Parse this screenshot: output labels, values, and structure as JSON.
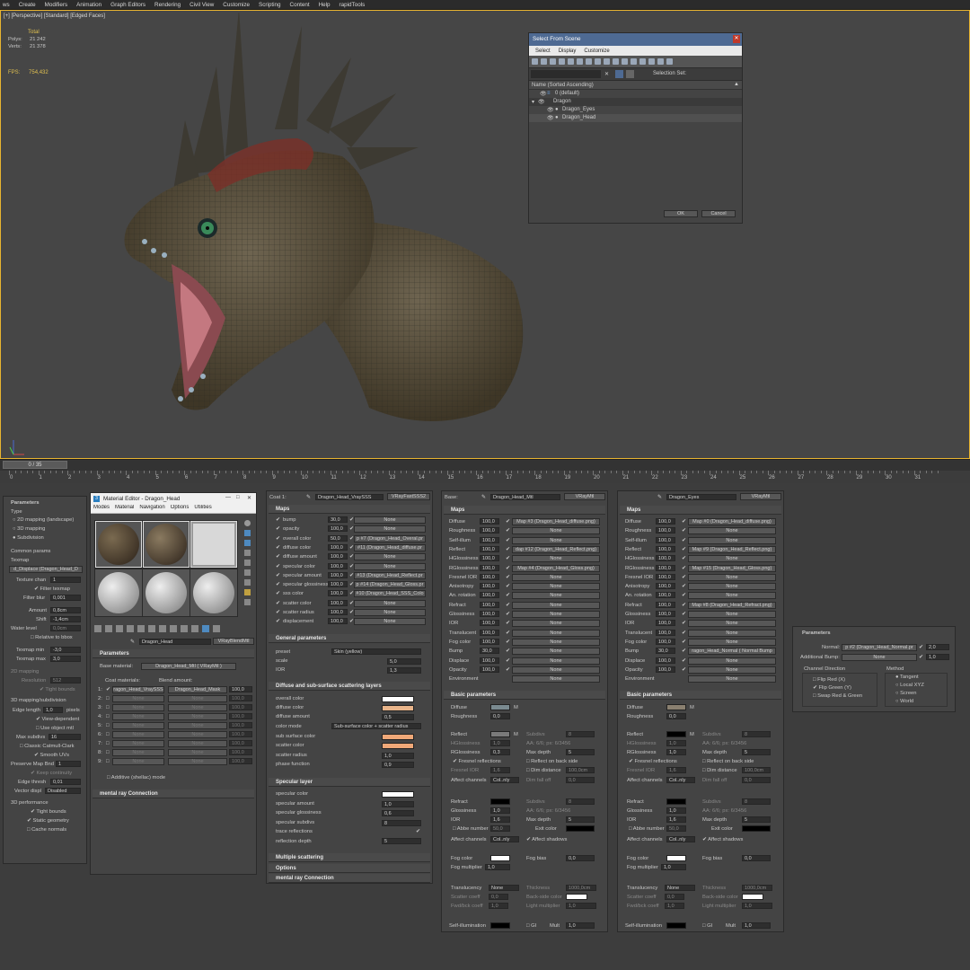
{
  "menubar": [
    "ws",
    "Create",
    "Modifiers",
    "Animation",
    "Graph Editors",
    "Rendering",
    "Civil View",
    "Customize",
    "Scripting",
    "Content",
    "Help",
    "rapidTools"
  ],
  "viewport": {
    "label": "[+] [Perspective] [Standard] [Edged Faces]",
    "stats": {
      "total_label": "Total",
      "polys_label": "Polys:",
      "polys": "21 242",
      "verts_label": "Verts:",
      "verts": "21 378"
    },
    "fps_label": "FPS:",
    "fps": "754,432"
  },
  "select_dialog": {
    "title": "Select From Scene",
    "menu": [
      "Select",
      "Display",
      "Customize"
    ],
    "selection_set_label": "Selection Set:",
    "column_header": "Name (Sorted Ascending)",
    "items": [
      {
        "name": "0 (default)",
        "indent": 1
      },
      {
        "name": "Dragon",
        "indent": 1
      },
      {
        "name": "Dragon_Eyes",
        "indent": 2
      },
      {
        "name": "Dragon_Head",
        "indent": 2
      }
    ],
    "ok": "OK",
    "cancel": "Cancel"
  },
  "timeline": {
    "slider": "0 / 35",
    "ticks": [
      "0",
      "1",
      "2",
      "3",
      "4",
      "5",
      "6",
      "7",
      "8",
      "9",
      "10",
      "11",
      "12",
      "13",
      "14",
      "15",
      "16",
      "17",
      "18",
      "19",
      "20",
      "21",
      "22",
      "23",
      "24",
      "25",
      "26",
      "27",
      "28",
      "29",
      "30",
      "31"
    ]
  },
  "params_panel": {
    "title": "Parameters",
    "type_label": "Type",
    "type_opts": [
      "2D mapping (landscape)",
      "3D mapping",
      "Subdivision"
    ],
    "common": "Common params",
    "texmap": "Texmap",
    "texmap_value": "d_Displace (Dragon_Head_D",
    "texture_chan_label": "Texture chan",
    "texture_chan": "1",
    "filter_texmap": "Filter texmap",
    "filter_blur_label": "Filter blur",
    "filter_blur": "0,001",
    "amount_label": "Amount",
    "amount": "0,8cm",
    "shift_label": "Shift",
    "shift": "-1,4cm",
    "water_label": "Water level",
    "water": "0,0cm",
    "relative": "Relative to bbox",
    "texmap_min_label": "Texmap min",
    "texmap_min": "-3,0",
    "texmap_max_label": "Texmap max",
    "texmap_max": "3,0",
    "mapping2d": "2D mapping",
    "resolution_label": "Resolution",
    "resolution": "512",
    "tight_bounds": "Tight bounds",
    "subdiv_section": "3D mapping/subdivision",
    "edge_length_label": "Edge length",
    "edge_length": "1,0",
    "pixels": "pixels",
    "view_dep": "View-dependent",
    "use_obj": "Use object mtl",
    "max_subdivs_label": "Max subdivs",
    "max_subdivs": "16",
    "classic": "Classic Catmull-Clark",
    "smooth_uvs": "Smooth UVs",
    "preserve_label": "Preserve Map Bnd",
    "preserve": "1",
    "keep_cont": "Keep continuity",
    "edge_thresh_label": "Edge thresh",
    "edge_thresh": "0,01",
    "vector_disp_label": "Vector displ",
    "vector_disp": "Disabled",
    "perf": "3D performance",
    "tight2": "Tight bounds",
    "static_geo": "Static geometry",
    "cache": "Cache normals"
  },
  "mat_editor": {
    "title": "Material Editor - Dragon_Head",
    "menu": [
      "Modes",
      "Material",
      "Navigation",
      "Options",
      "Utilities"
    ],
    "mat_name": "Dragon_Head",
    "mat_type": "VRayBlendMtl",
    "params_title": "Parameters",
    "base_label": "Base material:",
    "base_value": "Dragon_Head_Mtl  ( VRayMtl )",
    "coat_label": "Coat materials:",
    "blend_label": "Blend amount:",
    "coats": [
      {
        "n": "1:",
        "mat": "ragon_Head_VraySSS",
        "blend": "Dragon_Head_Mask",
        "amt": "100,0"
      },
      {
        "n": "2:",
        "mat": "None",
        "blend": "None",
        "amt": "100,0"
      },
      {
        "n": "3:",
        "mat": "None",
        "blend": "None",
        "amt": "100,0"
      },
      {
        "n": "4:",
        "mat": "None",
        "blend": "None",
        "amt": "100,0"
      },
      {
        "n": "5:",
        "mat": "None",
        "blend": "None",
        "amt": "100,0"
      },
      {
        "n": "6:",
        "mat": "None",
        "blend": "None",
        "amt": "100,0"
      },
      {
        "n": "7:",
        "mat": "None",
        "blend": "None",
        "amt": "100,0"
      },
      {
        "n": "8:",
        "mat": "None",
        "blend": "None",
        "amt": "100,0"
      },
      {
        "n": "9:",
        "mat": "None",
        "blend": "None",
        "amt": "100,0"
      }
    ],
    "additive": "Additive (shellac) mode",
    "mental": "mental ray Connection"
  },
  "coat_panel": {
    "coat_label": "Coat 1:",
    "mat_name": "Dragon_Head_VraySSS",
    "mat_type": "VRayFastSSS2",
    "maps": "Maps",
    "map_rows": [
      {
        "n": "bump",
        "v": "30,0",
        "m": "None"
      },
      {
        "n": "opacity",
        "v": "100,0",
        "m": "None"
      },
      {
        "n": "overall color",
        "v": "50,0",
        "m": "p #7 (Dragon_Head_Overal.pr"
      },
      {
        "n": "diffuse color",
        "v": "100,0",
        "m": "#11 (Dragon_Head_diffuse.pr"
      },
      {
        "n": "diffuse amount",
        "v": "100,0",
        "m": "None"
      },
      {
        "n": "specular color",
        "v": "100,0",
        "m": "None"
      },
      {
        "n": "specular amount",
        "v": "100,0",
        "m": "#13 (Dragon_Head_Reflect.pr"
      },
      {
        "n": "specular glossiness",
        "v": "100,0",
        "m": "p #14 (Dragon_Head_Gloss.pr"
      },
      {
        "n": "sss color",
        "v": "100,0",
        "m": "#10 (Dragon_Head_SSS_Colo"
      },
      {
        "n": "scatter color",
        "v": "100,0",
        "m": "None"
      },
      {
        "n": "scatter radius",
        "v": "100,0",
        "m": "None"
      },
      {
        "n": "displacement",
        "v": "100,0",
        "m": "None"
      }
    ],
    "general": "General parameters",
    "preset_label": "preset",
    "preset": "Skin (yellow)",
    "scale_label": "scale",
    "scale": "5,0",
    "ior_label": "IOR",
    "ior": "1,3",
    "diffuse_sss": "Diffuse and sub-surface scattering layers",
    "overall_color": "overall color",
    "diffuse_color": "diffuse color",
    "diffuse_amount": "diffuse amount",
    "diffuse_amount_v": "0,5",
    "color_mode": "color mode",
    "color_mode_v": "Sub-surface color + scatter radius",
    "sub_surface_color": "sub surface color",
    "scatter_color": "scatter color",
    "scatter_radius": "scatter radius",
    "scatter_radius_v": "1,0",
    "phase": "phase function",
    "phase_v": "0,9",
    "specular_layer": "Specular layer",
    "spec_color": "specular color",
    "spec_amount": "specular amount",
    "spec_amount_v": "1,0",
    "spec_gloss": "specular glossiness",
    "spec_gloss_v": "0,6",
    "spec_subdivs": "specular subdivs",
    "spec_subdivs_v": "8",
    "trace": "trace reflections",
    "refl_depth": "reflection depth",
    "refl_depth_v": "5",
    "multiple": "Multiple scattering",
    "options": "Options",
    "mental": "mental ray Connection"
  },
  "base_panel": {
    "base_label": "Base:",
    "mat_name": "Dragon_Head_Mtl",
    "mat_type": "VRayMtl",
    "maps": "Maps",
    "map_rows": [
      {
        "n": "Diffuse",
        "v": "100,0",
        "m": "Map #3 (Dragon_Head_diffuse.png)"
      },
      {
        "n": "Roughness",
        "v": "100,0",
        "m": "None"
      },
      {
        "n": "Self-illum",
        "v": "100,0",
        "m": "None"
      },
      {
        "n": "Reflect",
        "v": "100,0",
        "m": "dap #12 (Dragon_Head_Reflect.png)"
      },
      {
        "n": "HGlossiness",
        "v": "100,0",
        "m": "None"
      },
      {
        "n": "RGlossiness",
        "v": "100,0",
        "m": "Map #4 (Dragon_Head_Gloss.png)"
      },
      {
        "n": "Fresnel IOR",
        "v": "100,0",
        "m": "None"
      },
      {
        "n": "Anisotropy",
        "v": "100,0",
        "m": "None"
      },
      {
        "n": "An. rotation",
        "v": "100,0",
        "m": "None"
      },
      {
        "n": "Refract",
        "v": "100,0",
        "m": "None"
      },
      {
        "n": "Glossiness",
        "v": "100,0",
        "m": "None"
      },
      {
        "n": "IOR",
        "v": "100,0",
        "m": "None"
      },
      {
        "n": "Translucent",
        "v": "100,0",
        "m": "None"
      },
      {
        "n": "Fog color",
        "v": "100,0",
        "m": "None"
      },
      {
        "n": "Bump",
        "v": "30,0",
        "m": "None"
      },
      {
        "n": "Displace",
        "v": "100,0",
        "m": "None"
      },
      {
        "n": "Opacity",
        "v": "100,0",
        "m": "None"
      },
      {
        "n": "Environment",
        "v": "",
        "m": "None"
      }
    ],
    "basic": "Basic parameters",
    "diffuse": "Diffuse",
    "roughness": "Roughness",
    "roughness_v": "0,0",
    "reflect": "Reflect",
    "subdivs": "Subdivs",
    "subdivs_v": "8",
    "hgloss": "HGlossiness",
    "hgloss_v": "1,0",
    "aa": "AA: 6/6; px: 6/3456",
    "rgloss": "RGlossiness",
    "rgloss_v": "0,3",
    "max_depth": "Max depth",
    "max_depth_v": "5",
    "fresnel": "Fresnel reflections",
    "back_side": "Reflect on back side",
    "fresnel_ior": "Fresnel IOR",
    "fresnel_ior_v": "1,6",
    "dim_dist": "Dim distance",
    "dim_dist_v": "100,0cm",
    "affect": "Affect channels",
    "affect_v": "Col..nly",
    "dim_fall": "Dim fall off",
    "dim_fall_v": "0,0",
    "refract": "Refract",
    "r_subdivs": "Subdivs",
    "r_subdivs_v": "8",
    "glossiness": "Glossiness",
    "glossiness_v": "1,0",
    "r_aa": "AA: 6/6; px: 6/3456",
    "ior": "IOR",
    "ior_v": "1,6",
    "r_max_depth": "Max depth",
    "r_max_depth_v": "5",
    "abbe": "Abbe number",
    "abbe_v": "50,0",
    "exit": "Exit color",
    "affect2": "Affect channels",
    "affect2_v": "Col..nly",
    "affect_shadows": "Affect shadows",
    "fog_color": "Fog color",
    "fog_bias": "Fog bias",
    "fog_bias_v": "0,0",
    "fog_mult": "Fog multiplier",
    "fog_mult_v": "1,0",
    "translucency": "Translucency",
    "translucency_v": "None",
    "thickness": "Thickness",
    "thickness_v": "1000,0cm",
    "scatter": "Scatter coeff",
    "scatter_v": "0,0",
    "back_color": "Back-side color",
    "fwd": "Fwd/bck coeff",
    "fwd_v": "1,0",
    "light_mult": "Light multiplier",
    "light_mult_v": "1,0",
    "self_illum": "Self-illumination",
    "gi": "GI",
    "mult": "Mult",
    "mult_v": "1,0"
  },
  "eyes_panel": {
    "mat_name": "Dragon_Eyes",
    "mat_type": "VRayMtl",
    "maps": "Maps",
    "map_rows": [
      {
        "n": "Diffuse",
        "v": "100,0",
        "m": "Map #0 (Dragon_Head_diffuse.png)"
      },
      {
        "n": "Roughness",
        "v": "100,0",
        "m": "None"
      },
      {
        "n": "Self-illum",
        "v": "100,0",
        "m": "None"
      },
      {
        "n": "Reflect",
        "v": "100,0",
        "m": "Map #9 (Dragon_Head_Reflect.png)"
      },
      {
        "n": "HGlossiness",
        "v": "100,0",
        "m": "None"
      },
      {
        "n": "RGlossiness",
        "v": "100,0",
        "m": "Map #15 (Dragon_Head_Gloss.png)"
      },
      {
        "n": "Fresnel IOR",
        "v": "100,0",
        "m": "None"
      },
      {
        "n": "Anisotropy",
        "v": "100,0",
        "m": "None"
      },
      {
        "n": "An. rotation",
        "v": "100,0",
        "m": "None"
      },
      {
        "n": "Refract",
        "v": "100,0",
        "m": "Map #8 (Dragon_Head_Refract.png)"
      },
      {
        "n": "Glossiness",
        "v": "100,0",
        "m": "None"
      },
      {
        "n": "IOR",
        "v": "100,0",
        "m": "None"
      },
      {
        "n": "Translucent",
        "v": "100,0",
        "m": "None"
      },
      {
        "n": "Fog color",
        "v": "100,0",
        "m": "None"
      },
      {
        "n": "Bump",
        "v": "30,0",
        "m": "ragon_Head_Normal  ( Normal Bump"
      },
      {
        "n": "Displace",
        "v": "100,0",
        "m": "None"
      },
      {
        "n": "Opacity",
        "v": "100,0",
        "m": "None"
      },
      {
        "n": "Environment",
        "v": "",
        "m": "None"
      }
    ],
    "basic": "Basic parameters",
    "roughness_v": "0,0",
    "hgloss_v": "1,0",
    "rgloss_v": "1,0",
    "max_depth_v": "5",
    "fresnel_ior_v": "1,6",
    "dim_dist_v": "100,0cm",
    "affect_v": "Col..nly",
    "dim_fall_v": "0,0",
    "r_subdivs_v": "8",
    "glossiness_v": "1,0",
    "ior_v": "1,6",
    "r_max_depth_v": "5",
    "abbe_v": "50,0",
    "affect2_v": "Col..nly",
    "fog_bias_v": "0,0",
    "fog_mult_v": "1,0",
    "translucency_v": "None",
    "thickness_v": "1000,0cm",
    "scatter_v": "0,0",
    "fwd_v": "1,0",
    "light_mult_v": "1,0",
    "mult_v": "1,0"
  },
  "normal_panel": {
    "title": "Parameters",
    "normal_label": "Normal:",
    "normal_value": "p #2 (Dragon_Head_Normal.pr",
    "normal_amt": "2,0",
    "addbump_label": "Additional Bump:",
    "addbump_value": "None",
    "addbump_amt": "1,0",
    "channel": "Channel Direction",
    "flip_red": "Flip Red (X)",
    "flip_green": "Flip Green (Y)",
    "swap": "Swap Red & Green",
    "method": "Method",
    "methods": [
      "Tangent",
      "Local XYZ",
      "Screen",
      "World"
    ]
  },
  "colors": {
    "accent": "#e8b430",
    "title_blue": "#4e6a93",
    "skin": "#e8b48a",
    "sub_surface": "#f0a878"
  }
}
